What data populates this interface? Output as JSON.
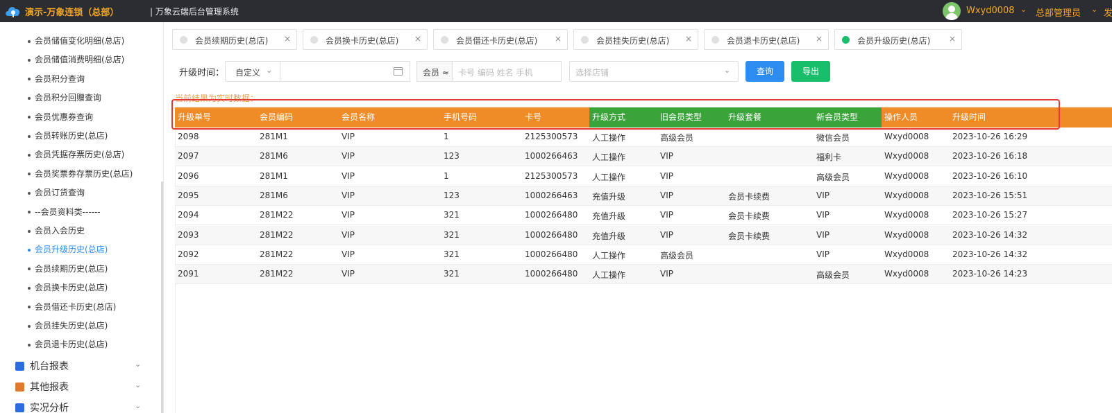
{
  "topbar": {
    "brand": "演示-万象连锁（总部）",
    "system_title": "| 万象云端后台管理系统",
    "user_name": "Wxyd0008",
    "role_name": "总部管理员",
    "extra": "发",
    "caret": "⌄"
  },
  "sidebar": {
    "items": [
      {
        "label": "会员储值变化明细(总店)"
      },
      {
        "label": "会员储值消费明细(总店)"
      },
      {
        "label": "会员积分查询"
      },
      {
        "label": "会员积分回赠查询"
      },
      {
        "label": "会员优惠券查询"
      },
      {
        "label": "会员转账历史(总店)"
      },
      {
        "label": "会员凭据存票历史(总店)"
      },
      {
        "label": "会员奖票券存票历史(总店)"
      },
      {
        "label": "会员订货查询"
      },
      {
        "label": "--会员资料类------"
      },
      {
        "label": "会员入会历史"
      },
      {
        "label": "会员升级历史(总店)"
      },
      {
        "label": "会员续期历史(总店)"
      },
      {
        "label": "会员换卡历史(总店)"
      },
      {
        "label": "会员借还卡历史(总店)"
      },
      {
        "label": "会员挂失历史(总店)"
      },
      {
        "label": "会员退卡历史(总店)"
      }
    ],
    "active_index": 11,
    "groups": [
      {
        "label": "机台报表",
        "color": "#2d6cdf"
      },
      {
        "label": "其他报表",
        "color": "#e07a2e"
      },
      {
        "label": "实况分析",
        "color": "#2d6cdf"
      }
    ]
  },
  "tabs": [
    {
      "label": "会员续期历史(总店)",
      "active": false
    },
    {
      "label": "会员换卡历史(总店)",
      "active": false
    },
    {
      "label": "会员借还卡历史(总店)",
      "active": false
    },
    {
      "label": "会员挂失历史(总店)",
      "active": false
    },
    {
      "label": "会员退卡历史(总店)",
      "active": false
    },
    {
      "label": "会员升级历史(总店)",
      "active": true
    }
  ],
  "filter": {
    "label": "升级时间：",
    "date_type": "自定义",
    "member_type": "会员 ≈",
    "member_placeholder": "卡号 编码 姓名 手机",
    "store_placeholder": "选择店铺",
    "query_button": "查询",
    "export_button": "导出"
  },
  "notice": "当前结果为实时数据：",
  "table": {
    "columns": [
      {
        "label": "升级单号",
        "color": "orange"
      },
      {
        "label": "会员编码",
        "color": "orange"
      },
      {
        "label": "会员名称",
        "color": "orange"
      },
      {
        "label": "手机号码",
        "color": "orange"
      },
      {
        "label": "卡号",
        "color": "orange"
      },
      {
        "label": "升级方式",
        "color": "green"
      },
      {
        "label": "旧会员类型",
        "color": "green"
      },
      {
        "label": "升级套餐",
        "color": "green"
      },
      {
        "label": "新会员类型",
        "color": "green"
      },
      {
        "label": "操作人员",
        "color": "orange"
      },
      {
        "label": "升级时间",
        "color": "orange"
      }
    ],
    "rows": [
      [
        "2098",
        "281M1",
        "VIP",
        "1",
        "2125300573",
        "人工操作",
        "高级会员",
        "",
        "微信会员",
        "Wxyd0008",
        "2023-10-26 16:29"
      ],
      [
        "2097",
        "281M6",
        "VIP",
        "123",
        "1000266463",
        "人工操作",
        "VIP",
        "",
        "福利卡",
        "Wxyd0008",
        "2023-10-26 16:18"
      ],
      [
        "2096",
        "281M1",
        "VIP",
        "1",
        "2125300573",
        "人工操作",
        "VIP",
        "",
        "高级会员",
        "Wxyd0008",
        "2023-10-26 16:10"
      ],
      [
        "2095",
        "281M6",
        "VIP",
        "123",
        "1000266463",
        "充值升级",
        "VIP",
        "会员卡续费",
        "VIP",
        "Wxyd0008",
        "2023-10-26 15:51"
      ],
      [
        "2094",
        "281M22",
        "VIP",
        "321",
        "1000266480",
        "充值升级",
        "VIP",
        "会员卡续费",
        "VIP",
        "Wxyd0008",
        "2023-10-26 15:27"
      ],
      [
        "2093",
        "281M22",
        "VIP",
        "321",
        "1000266480",
        "充值升级",
        "VIP",
        "会员卡续费",
        "VIP",
        "Wxyd0008",
        "2023-10-26 14:32"
      ],
      [
        "2092",
        "281M22",
        "VIP",
        "321",
        "1000266480",
        "人工操作",
        "高级会员",
        "",
        "VIP",
        "Wxyd0008",
        "2023-10-26 14:32"
      ],
      [
        "2091",
        "281M22",
        "VIP",
        "321",
        "1000266480",
        "人工操作",
        "VIP",
        "",
        "高级会员",
        "Wxyd0008",
        "2023-10-26 14:23"
      ]
    ]
  },
  "colors": {
    "orange_header": "#f08c28",
    "green_header": "#3aa33a",
    "primary": "#2d8cf0",
    "success": "#19be6b",
    "highlight": "#e53935"
  }
}
